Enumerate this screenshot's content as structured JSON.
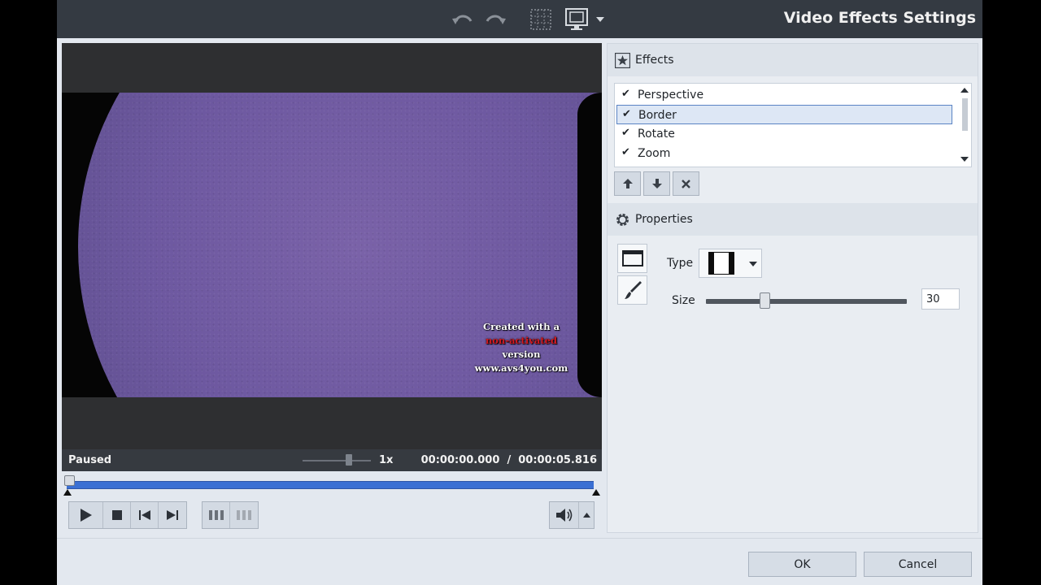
{
  "window": {
    "title": "Video Effects Settings"
  },
  "toolbar": {
    "undo_icon": "undo-icon",
    "redo_icon": "redo-icon",
    "grid_icon": "grid-icon",
    "monitor_icon": "monitor-icon"
  },
  "preview": {
    "watermark": {
      "line1": "Created with a",
      "line2_red": "non-activated",
      "line2_rest": " version",
      "line3": "www.avs4you.com"
    }
  },
  "status": {
    "state": "Paused",
    "speed": "1x",
    "speed_level": 0.68,
    "current_time": "00:00:00.000",
    "separator": "/",
    "total_time": "00:00:05.816"
  },
  "playback": {
    "buttons": [
      "play-icon",
      "stop-icon",
      "previous-icon",
      "next-icon"
    ],
    "volume_icon": "speaker-icon"
  },
  "effects": {
    "header": "Effects",
    "items": [
      {
        "name": "Perspective",
        "checked": "✔"
      },
      {
        "name": "Border",
        "checked": "✔"
      },
      {
        "name": "Rotate",
        "checked": "✔"
      },
      {
        "name": "Zoom",
        "checked": "✔"
      }
    ],
    "selected": "Border"
  },
  "properties": {
    "header": "Properties",
    "type_label": "Type",
    "size_label": "Size",
    "size_value": "30",
    "size_level": 0.29
  },
  "footer": {
    "ok_label": "OK",
    "cancel_label": "Cancel"
  },
  "colors": {
    "titlebar": "#343a42",
    "timeline": "#3a6fd3",
    "watermark_red": "#d2181f"
  }
}
